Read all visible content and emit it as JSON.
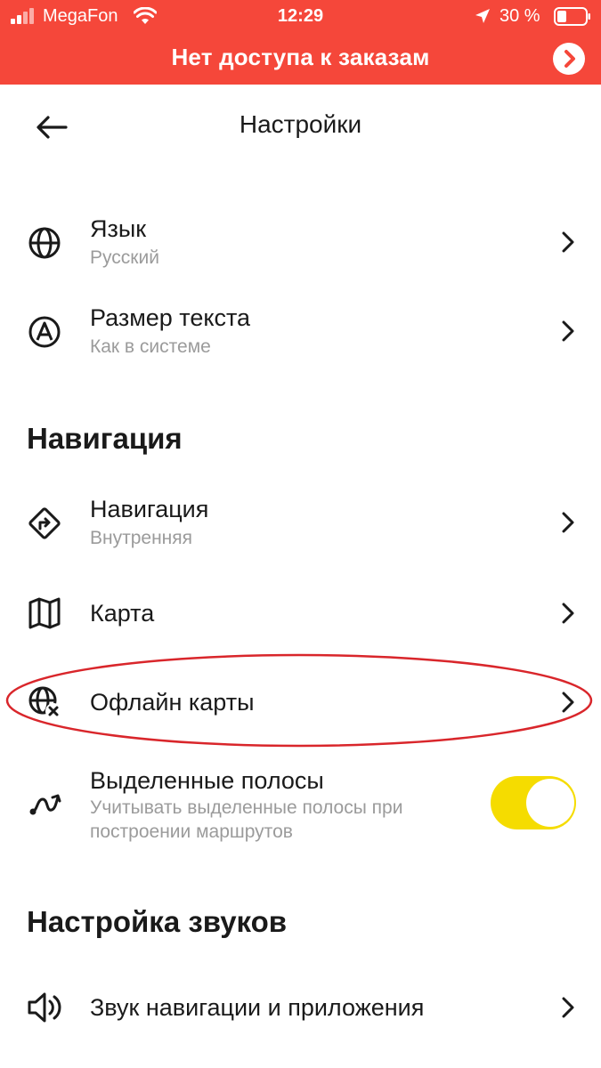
{
  "status_bar": {
    "carrier": "MegaFon",
    "time": "12:29",
    "battery": "30 %"
  },
  "banner": {
    "text": "Нет доступа к заказам"
  },
  "header": {
    "title": "Настройки"
  },
  "settings": {
    "language": {
      "label": "Язык",
      "value": "Русский",
      "icon": "globe-icon"
    },
    "text_size": {
      "label": "Размер текста",
      "value": "Как в системе",
      "icon": "text-size-icon"
    }
  },
  "sections": {
    "navigation": "Навигация",
    "sounds": "Настройка звуков"
  },
  "navigation": {
    "navigator": {
      "label": "Навигация",
      "value": "Внутренняя",
      "icon": "route-sign-icon"
    },
    "map": {
      "label": "Карта",
      "icon": "map-icon"
    },
    "offline_maps": {
      "label": "Офлайн карты",
      "icon": "offline-globe-icon"
    },
    "dedicated_lanes": {
      "label": "Выделенные полосы",
      "value": "Учитывать выделенные полосы при построении маршрутов",
      "icon": "lane-route-icon",
      "enabled": true
    }
  },
  "sounds": {
    "navigation_sound": {
      "label": "Звук навигации и приложения",
      "icon": "speaker-icon"
    }
  },
  "colors": {
    "banner": "#f5473a",
    "toggle_on": "#f5dc00",
    "highlight_ring": "#d9262b",
    "secondary_text": "#9b9b9b"
  }
}
